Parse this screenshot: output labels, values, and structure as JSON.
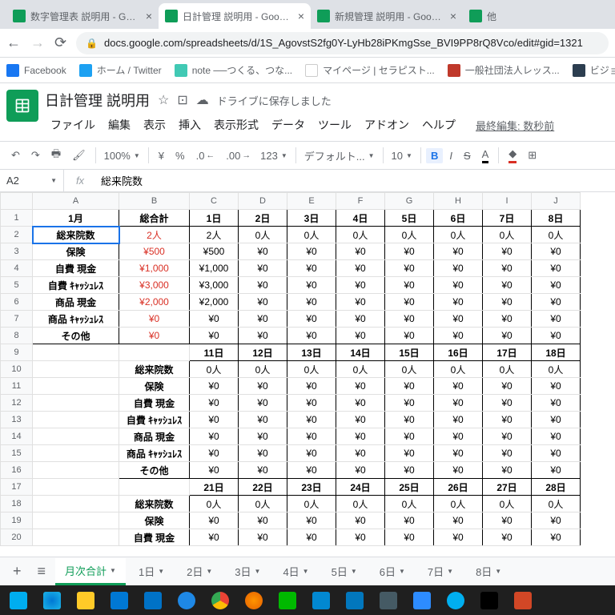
{
  "browser": {
    "tabs": [
      {
        "title": "数字管理表 説明用 - Google スプ"
      },
      {
        "title": "日計管理 説明用 - Google スプレッ"
      },
      {
        "title": "新規管理 説明用 - Google スプレ"
      },
      {
        "title": "他"
      }
    ],
    "url": "docs.google.com/spreadsheets/d/1S_AgovstS2fg0Y-LyHb28iPKmgSse_BVI9PP8rQ8Vco/edit#gid=1321"
  },
  "bookmarks": [
    {
      "label": "Facebook"
    },
    {
      "label": "ホーム / Twitter"
    },
    {
      "label": "note ──つくる、つな..."
    },
    {
      "label": "マイページ | セラピスト..."
    },
    {
      "label": "一般社団法人レッス..."
    },
    {
      "label": "ビジョントレー..."
    }
  ],
  "doc": {
    "title": "日計管理 説明用",
    "save_status": "ドライブに保存しました",
    "last_edit": "最終編集: 数秒前"
  },
  "menus": [
    "ファイル",
    "編集",
    "表示",
    "挿入",
    "表示形式",
    "データ",
    "ツール",
    "アドオン",
    "ヘルプ"
  ],
  "toolbar": {
    "zoom": "100%",
    "font": "デフォルト...",
    "size": "10",
    "decimals_dec": ".0",
    "decimals_inc": ".00",
    "format": "123"
  },
  "name_box": "A2",
  "formula": "総来院数",
  "columns": [
    "A",
    "B",
    "C",
    "D",
    "E",
    "F",
    "G",
    "H",
    "I",
    "J"
  ],
  "rows_n": 20,
  "section1": {
    "header_a": "1月",
    "header_b": "総合計",
    "days": [
      "1日",
      "2日",
      "3日",
      "4日",
      "5日",
      "6日",
      "7日",
      "8日"
    ],
    "rows": [
      {
        "label": "総来院数",
        "total": "2人",
        "vals": [
          "2人",
          "0人",
          "0人",
          "0人",
          "0人",
          "0人",
          "0人",
          "0人"
        ],
        "red": true,
        "sel": true
      },
      {
        "label": "保険",
        "total": "¥500",
        "vals": [
          "¥500",
          "¥0",
          "¥0",
          "¥0",
          "¥0",
          "¥0",
          "¥0",
          "¥0"
        ],
        "red": true
      },
      {
        "label": "自費 現金",
        "total": "¥1,000",
        "vals": [
          "¥1,000",
          "¥0",
          "¥0",
          "¥0",
          "¥0",
          "¥0",
          "¥0",
          "¥0"
        ],
        "red": true
      },
      {
        "label": "自費 ｷｬｯｼｭﾚｽ",
        "total": "¥3,000",
        "vals": [
          "¥3,000",
          "¥0",
          "¥0",
          "¥0",
          "¥0",
          "¥0",
          "¥0",
          "¥0"
        ],
        "red": true
      },
      {
        "label": "商品 現金",
        "total": "¥2,000",
        "vals": [
          "¥2,000",
          "¥0",
          "¥0",
          "¥0",
          "¥0",
          "¥0",
          "¥0",
          "¥0"
        ],
        "red": true
      },
      {
        "label": "商品 ｷｬｯｼｭﾚｽ",
        "total": "¥0",
        "vals": [
          "¥0",
          "¥0",
          "¥0",
          "¥0",
          "¥0",
          "¥0",
          "¥0",
          "¥0"
        ],
        "red": true
      },
      {
        "label": "その他",
        "total": "¥0",
        "vals": [
          "¥0",
          "¥0",
          "¥0",
          "¥0",
          "¥0",
          "¥0",
          "¥0",
          "¥0"
        ],
        "red": true
      }
    ]
  },
  "section2": {
    "days": [
      "11日",
      "12日",
      "13日",
      "14日",
      "15日",
      "16日",
      "17日",
      "18日"
    ],
    "rows": [
      {
        "label": "総来院数",
        "vals": [
          "0人",
          "0人",
          "0人",
          "0人",
          "0人",
          "0人",
          "0人",
          "0人"
        ]
      },
      {
        "label": "保険",
        "vals": [
          "¥0",
          "¥0",
          "¥0",
          "¥0",
          "¥0",
          "¥0",
          "¥0",
          "¥0"
        ]
      },
      {
        "label": "自費 現金",
        "vals": [
          "¥0",
          "¥0",
          "¥0",
          "¥0",
          "¥0",
          "¥0",
          "¥0",
          "¥0"
        ]
      },
      {
        "label": "自費 ｷｬｯｼｭﾚｽ",
        "vals": [
          "¥0",
          "¥0",
          "¥0",
          "¥0",
          "¥0",
          "¥0",
          "¥0",
          "¥0"
        ]
      },
      {
        "label": "商品 現金",
        "vals": [
          "¥0",
          "¥0",
          "¥0",
          "¥0",
          "¥0",
          "¥0",
          "¥0",
          "¥0"
        ]
      },
      {
        "label": "商品 ｷｬｯｼｭﾚｽ",
        "vals": [
          "¥0",
          "¥0",
          "¥0",
          "¥0",
          "¥0",
          "¥0",
          "¥0",
          "¥0"
        ]
      },
      {
        "label": "その他",
        "vals": [
          "¥0",
          "¥0",
          "¥0",
          "¥0",
          "¥0",
          "¥0",
          "¥0",
          "¥0"
        ]
      }
    ]
  },
  "section3": {
    "days": [
      "21日",
      "22日",
      "23日",
      "24日",
      "25日",
      "26日",
      "27日",
      "28日"
    ],
    "rows": [
      {
        "label": "総来院数",
        "vals": [
          "0人",
          "0人",
          "0人",
          "0人",
          "0人",
          "0人",
          "0人",
          "0人"
        ]
      },
      {
        "label": "保険",
        "vals": [
          "¥0",
          "¥0",
          "¥0",
          "¥0",
          "¥0",
          "¥0",
          "¥0",
          "¥0"
        ]
      },
      {
        "label": "自費 現金",
        "vals": [
          "¥0",
          "¥0",
          "¥0",
          "¥0",
          "¥0",
          "¥0",
          "¥0",
          "¥0"
        ]
      }
    ]
  },
  "sheet_tabs": {
    "active": "月次合計",
    "others": [
      "1日",
      "2日",
      "3日",
      "4日",
      "5日",
      "6日",
      "7日",
      "8日"
    ]
  }
}
